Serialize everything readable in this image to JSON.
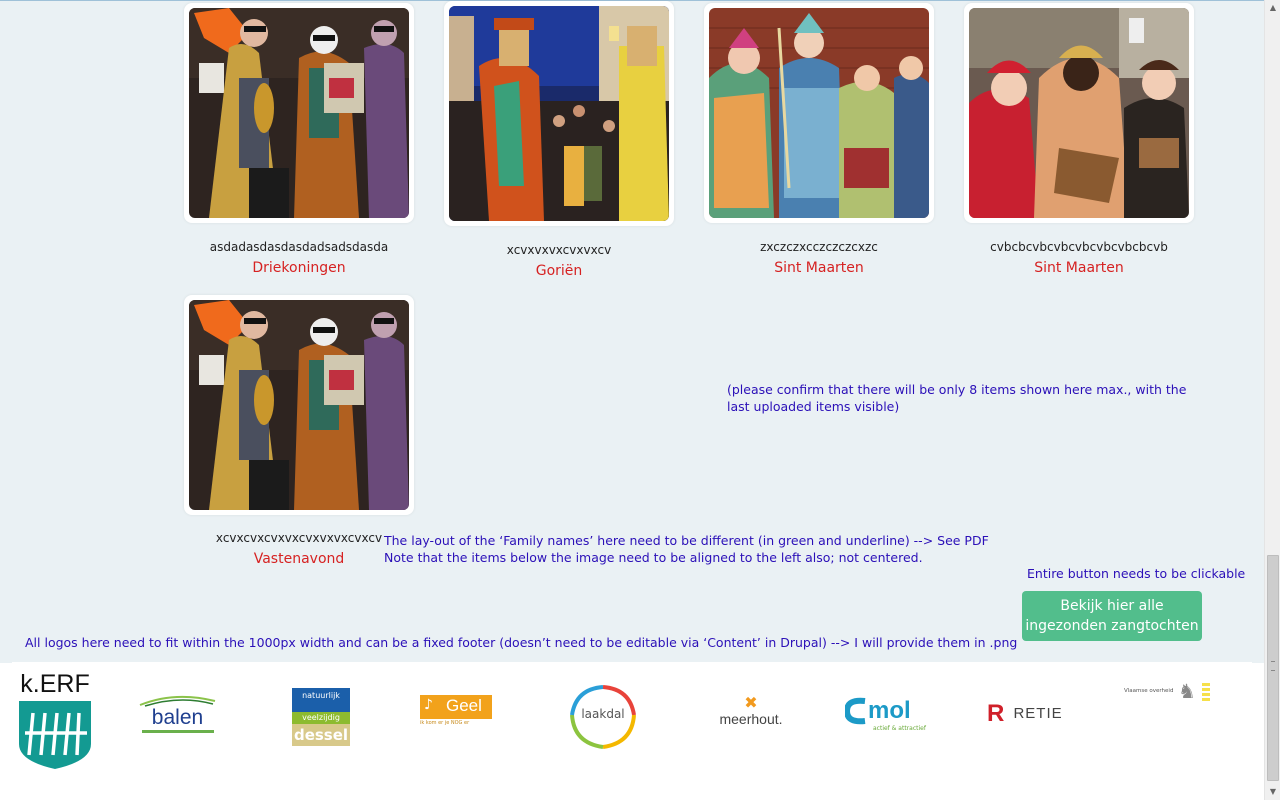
{
  "gallery": [
    {
      "title": "asdadasdasdasdadsadsdasda",
      "family": "Driekoningen"
    },
    {
      "title": "xcvxvxvxcvxvxcv",
      "family": "Goriën"
    },
    {
      "title": "zxczczxcczczczcxzc",
      "family": "Sint Maarten"
    },
    {
      "title": "cvbcbcvbcvbcvbcvbcvbcbcvb",
      "family": "Sint Maarten"
    },
    {
      "title": "xcvxcvxcvxvxcvxvxvxcvxcv",
      "family": "Vastenavond"
    }
  ],
  "notes": {
    "max_items": "(please confirm that there will be only 8 items shown here max., with the last uploaded items visible)",
    "layout_line1": "The lay-out of the ‘Family names’ here need to be different (in green and underline) --> See PDF",
    "layout_line2": "Note that the items below the image need to be aligned to the left also; not centered.",
    "button": "Entire button needs to be clickable",
    "logos": "All logos here need to fit within the 1000px width and can be a fixed footer (doesn’t need to be editable via ‘Content’ in Drupal) --> I will provide them in .png"
  },
  "cta": {
    "line1": "Bekijk hier alle",
    "line2": "ingezonden zangtochten"
  },
  "logos": {
    "kerf": "k.ERF",
    "balen": "balen",
    "dessel_top": "natuurlijk",
    "dessel_mid": "veelzijdig",
    "dessel": "dessel",
    "geel": "Geel",
    "geel_sub": "ik kom er je NOG er",
    "laakdal": "laakdal",
    "meerhout": "meerhout.",
    "mol": "mol",
    "mol_sub": "actief & attractief",
    "retie": "RETIE",
    "vlaanderen": "Vlaamse overheid"
  },
  "colors": {
    "note": "#2b10b8",
    "family": "#d62222",
    "button": "#52be8c",
    "background": "#eaf1f4"
  }
}
